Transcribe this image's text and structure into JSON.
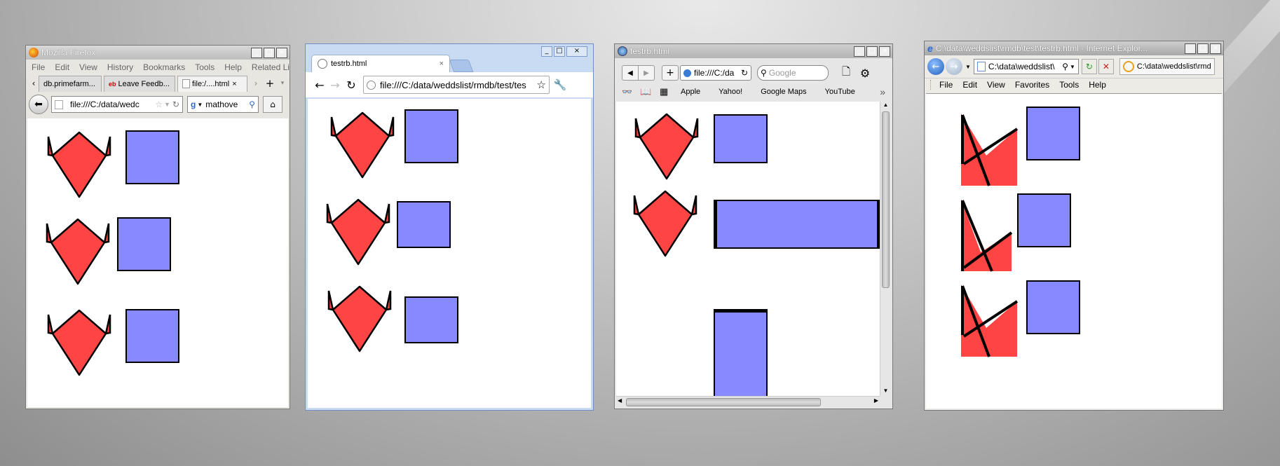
{
  "colors": {
    "shape_fill": "#ff4444",
    "square_fill": "#8888ff",
    "stroke": "#000000"
  },
  "firefox": {
    "title": "Mozilla Firefox",
    "menu": [
      "File",
      "Edit",
      "View",
      "History",
      "Bookmarks",
      "Tools",
      "Help",
      "Related Links"
    ],
    "tabs": [
      "db.primefarm...",
      "Leave Feedb...",
      "file:/....html"
    ],
    "url": "file:///C:/data/wedc",
    "search": "mathove"
  },
  "chrome": {
    "tab_title": "testrb.html",
    "url": "file:///C:/data/weddslist/rmdb/test/tes"
  },
  "safari": {
    "title": "testrb.html",
    "url": "file:///C:/da",
    "search_placeholder": "Google",
    "bookmarks": [
      "Apple",
      "Yahoo!",
      "Google Maps",
      "YouTube"
    ]
  },
  "ie": {
    "title": "C:\\data\\weddslist\\rmdb\\test\\testrb.html - Internet Explor...",
    "url": "C:\\data\\weddslist\\",
    "tab": "C:\\data\\weddslist\\rmd...",
    "menu": [
      "File",
      "Edit",
      "View",
      "Favorites",
      "Tools",
      "Help"
    ]
  }
}
